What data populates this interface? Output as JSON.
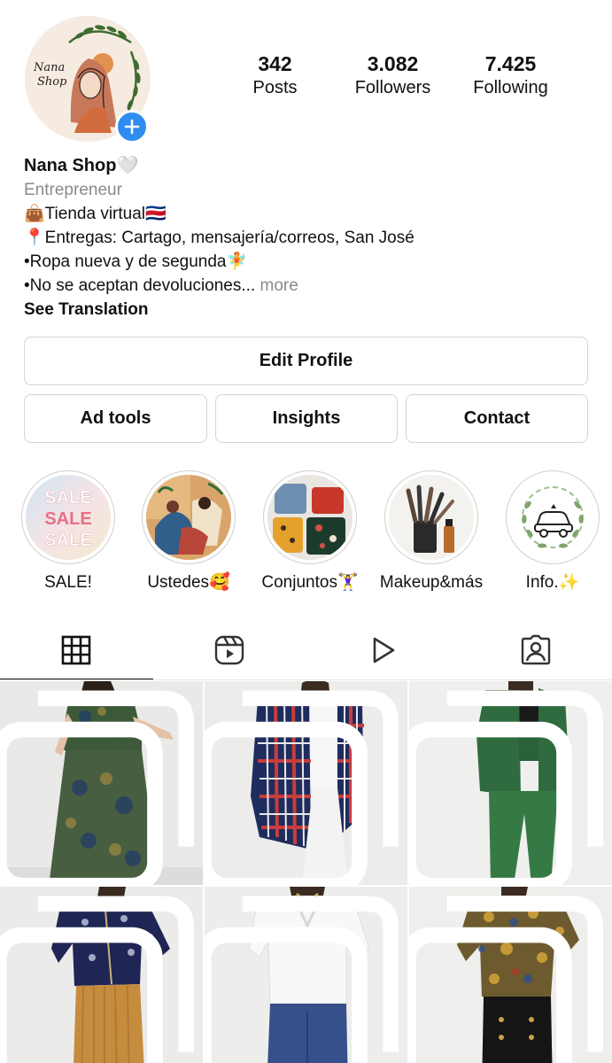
{
  "profile": {
    "name": "Nana Shop🤍",
    "category": "Entrepreneur",
    "bio": [
      "👜Tienda virtual🇨🇷",
      "📍Entregas: Cartago, mensajería/correos, San José",
      "•Ropa nueva y de segunda🧚",
      "•No se aceptan devoluciones..."
    ],
    "more_label": "more",
    "see_translation": "See Translation",
    "avatar_text": "Nana Shop"
  },
  "stats": [
    {
      "value": "342",
      "label": "Posts"
    },
    {
      "value": "3.082",
      "label": "Followers"
    },
    {
      "value": "7.425",
      "label": "Following"
    }
  ],
  "buttons": {
    "edit_profile": "Edit Profile",
    "ad_tools": "Ad tools",
    "insights": "Insights",
    "contact": "Contact"
  },
  "highlights": [
    {
      "label": "SALE!",
      "icon": "sale-text",
      "cover_text": [
        "SALE",
        "SALE",
        "SALE"
      ]
    },
    {
      "label": "Ustedes🥰",
      "icon": "illustration"
    },
    {
      "label": "Conjuntos🏋️‍♀️",
      "icon": "clothes-photo"
    },
    {
      "label": "Makeup&más",
      "icon": "makeup-brushes"
    },
    {
      "label": "Info.✨",
      "icon": "delivery-car"
    }
  ],
  "tabs": [
    {
      "name": "grid",
      "icon": "grid-icon",
      "active": true
    },
    {
      "name": "reels",
      "icon": "reels-icon",
      "active": false
    },
    {
      "name": "videos",
      "icon": "play-icon",
      "active": false
    },
    {
      "name": "tagged",
      "icon": "tagged-icon",
      "active": false
    }
  ],
  "posts": [
    {
      "item": "green patterned two-piece set",
      "multiple": true
    },
    {
      "item": "navy plaid flannel shirt",
      "multiple": true
    },
    {
      "item": "green suit set",
      "multiple": true
    },
    {
      "item": "navy floral blouse with corduroy skirt",
      "multiple": true
    },
    {
      "item": "white knit polo top",
      "multiple": true
    },
    {
      "item": "paisley print shirt",
      "multiple": true
    }
  ],
  "colors": {
    "accent_blue": "#2f8cf0",
    "border": "#d4d4d4",
    "muted_text": "#8a8a8a"
  }
}
